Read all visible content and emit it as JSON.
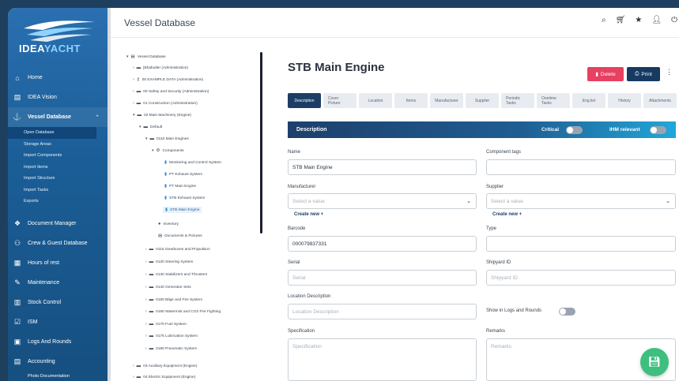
{
  "brand": {
    "name_part1": "IDEA",
    "name_part2": "YACHT"
  },
  "sidebar": {
    "items": [
      {
        "label": "Home",
        "icon": "home-icon"
      },
      {
        "label": "IDEA Vision",
        "icon": "vision-icon"
      },
      {
        "label": "Vessel Database",
        "icon": "anchor-icon"
      },
      {
        "label": "Document Manager",
        "icon": "document-icon"
      },
      {
        "label": "Crew & Guest Database",
        "icon": "people-icon"
      },
      {
        "label": "Hours of rest",
        "icon": "calendar-icon"
      },
      {
        "label": "Maintenance",
        "icon": "wrench-icon"
      },
      {
        "label": "Stock Control",
        "icon": "stock-icon"
      },
      {
        "label": "ISM",
        "icon": "check-icon"
      },
      {
        "label": "Logs And Rounds",
        "icon": "log-icon"
      },
      {
        "label": "Accounting",
        "icon": "accounting-icon"
      }
    ],
    "sub_items": [
      "Open Database",
      "Storage Areas",
      "Import Components",
      "Import Items",
      "Import Structure",
      "Import Tasks",
      "Exports"
    ],
    "footer_item": "Photo Documentation"
  },
  "header": {
    "title": "Vessel Database",
    "tools": [
      "search-icon",
      "cart-icon",
      "star-icon",
      "user-icon",
      "power-icon"
    ]
  },
  "tree": {
    "rows": [
      {
        "label": "Vessel Database",
        "level": 0,
        "toggle": "▾"
      },
      {
        "label": "[Bhabutler (Administration)",
        "level": 1,
        "toggle": "›"
      },
      {
        "label": "00 EXAMPLE DATA (Administration)",
        "level": 1,
        "toggle": "›"
      },
      {
        "label": "00 Safety and Security (Administration)",
        "level": 1,
        "toggle": "›"
      },
      {
        "label": "01 Construction (Administration)",
        "level": 1,
        "toggle": "›"
      },
      {
        "label": "02 Main Machinery (Engine)",
        "level": 1,
        "toggle": "▾"
      },
      {
        "label": "Default",
        "level": 2,
        "toggle": "▾"
      },
      {
        "label": "0110 Main Engines",
        "level": 3,
        "toggle": "▾"
      },
      {
        "label": "Components",
        "level": 4,
        "toggle": "▾"
      },
      {
        "label": "Monitoring and Control System",
        "level": 5,
        "toggle": ""
      },
      {
        "label": "PT Exhaust System",
        "level": 5,
        "toggle": ""
      },
      {
        "label": "PT Main Engine",
        "level": 5,
        "toggle": ""
      },
      {
        "label": "STB Exhaust System",
        "level": 5,
        "toggle": ""
      },
      {
        "label": "STB Main Engine",
        "level": 5,
        "toggle": "",
        "selected": true
      },
      {
        "label": "Inventory",
        "level": 4,
        "toggle": ""
      },
      {
        "label": "Documents & Pictures",
        "level": 4,
        "toggle": ""
      },
      {
        "label": "0115 Gearboxes and Propulsion",
        "level": 3,
        "toggle": "›"
      },
      {
        "label": "0120 Steering System",
        "level": 3,
        "toggle": "›"
      },
      {
        "label": "0130 Stabilizers and Thrusters",
        "level": 3,
        "toggle": "›"
      },
      {
        "label": "0140 Generator Sets",
        "level": 3,
        "toggle": "›"
      },
      {
        "label": "0150 Bilge and Fire System",
        "level": 3,
        "toggle": "›"
      },
      {
        "label": "0160 Watermist and CO2 Fire Fighting",
        "level": 3,
        "toggle": "›"
      },
      {
        "label": "0170 Fuel System",
        "level": 3,
        "toggle": "›"
      },
      {
        "label": "0175 Lubrication System",
        "level": 3,
        "toggle": "›"
      },
      {
        "label": "0180 Pneumatic System",
        "level": 3,
        "toggle": "›"
      },
      {
        "label": "03 Auxiliary Equipment (Engine)",
        "level": 1,
        "toggle": "›"
      },
      {
        "label": "04 Electric Equipment (Engine)",
        "level": 1,
        "toggle": "›"
      }
    ]
  },
  "main": {
    "title": "STB Main Engine",
    "delete_label": "Delete",
    "print_label": "Print",
    "tabs": [
      "Description",
      "Cover Picture",
      "Location",
      "Items",
      "Manufacturer",
      "Supplier",
      "Periodic Tasks",
      "Onetime Tasks",
      "Eng.list",
      "History",
      "Attachments"
    ],
    "section_title": "Description",
    "critical_label": "Critical",
    "ihm_label": "IHM relevant",
    "fields": {
      "name_label": "Name",
      "name_value": "STB Main Engine",
      "tags_label": "Component tags",
      "manufacturer_label": "Manufacturer",
      "manufacturer_placeholder": "Select a value",
      "supplier_label": "Supplier",
      "supplier_placeholder": "Select a value",
      "create_new": "Create new +",
      "barcode_label": "Barcode",
      "barcode_value": "000079837331",
      "type_label": "Type",
      "serial_label": "Serial",
      "serial_placeholder": "Serial",
      "shipyard_label": "Shipyard ID",
      "shipyard_placeholder": "Shipyard ID",
      "location_label": "Location Description",
      "location_placeholder": "Location Description",
      "show_logs_label": "Show in Logs and Rounds",
      "spec_label": "Specification",
      "spec_placeholder": "Specification",
      "remarks_label": "Remarks",
      "remarks_placeholder": "Remarks"
    }
  },
  "colors": {
    "accent": "#1c3e66",
    "delete": "#e74060",
    "save": "#3fbf7f"
  }
}
